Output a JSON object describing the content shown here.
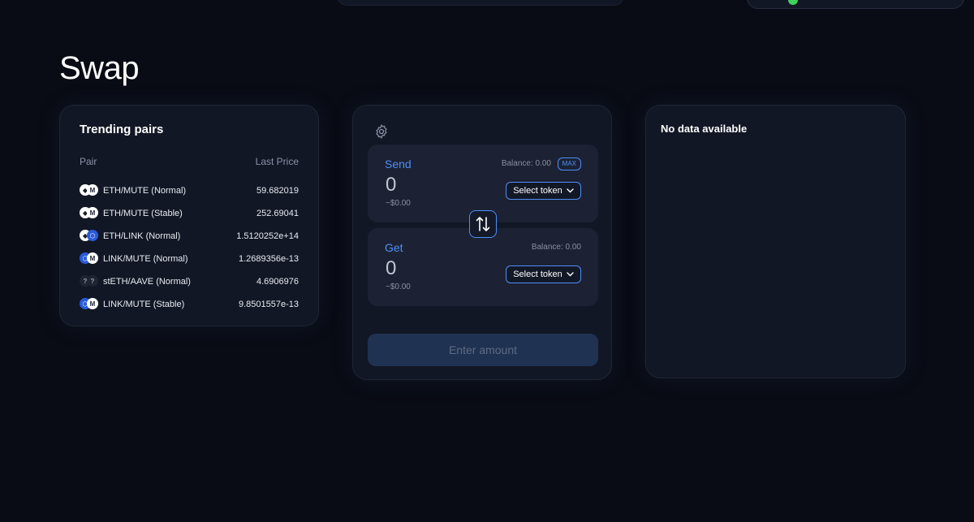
{
  "page": {
    "title": "Swap"
  },
  "trending": {
    "title": "Trending pairs",
    "col_pair": "Pair",
    "col_price": "Last Price",
    "rows": [
      {
        "pair": "ETH/MUTE (Normal)",
        "price": "59.682019",
        "token_a": "eth",
        "token_b": "mute"
      },
      {
        "pair": "ETH/MUTE (Stable)",
        "price": "252.69041",
        "token_a": "eth",
        "token_b": "mute"
      },
      {
        "pair": "ETH/LINK (Normal)",
        "price": "1.5120252e+14",
        "token_a": "eth",
        "token_b": "link"
      },
      {
        "pair": "LINK/MUTE (Normal)",
        "price": "1.2689356e-13",
        "token_a": "link",
        "token_b": "mute"
      },
      {
        "pair": "stETH/AAVE (Normal)",
        "price": "4.6906976",
        "token_a": "unknown",
        "token_b": "unknown"
      },
      {
        "pair": "LINK/MUTE (Stable)",
        "price": "9.8501557e-13",
        "token_a": "link",
        "token_b": "mute"
      }
    ]
  },
  "swap": {
    "send": {
      "label": "Send",
      "amount": "0",
      "usd": "~$0.00",
      "balance": "Balance: 0.00",
      "max_label": "MAX",
      "select_label": "Select token"
    },
    "get": {
      "label": "Get",
      "amount": "0",
      "usd": "~$0.00",
      "balance": "Balance: 0.00",
      "select_label": "Select token"
    },
    "submit_label": "Enter amount",
    "icons": {
      "settings": "gear-icon",
      "switch": "swap-arrows-icon",
      "dropdown": "chevron-down-icon"
    }
  },
  "chart_panel": {
    "message": "No data available"
  },
  "colors": {
    "accent": "#4f8ef7",
    "background": "#090c14",
    "card": "#121725",
    "status_online": "#3fd15a"
  }
}
